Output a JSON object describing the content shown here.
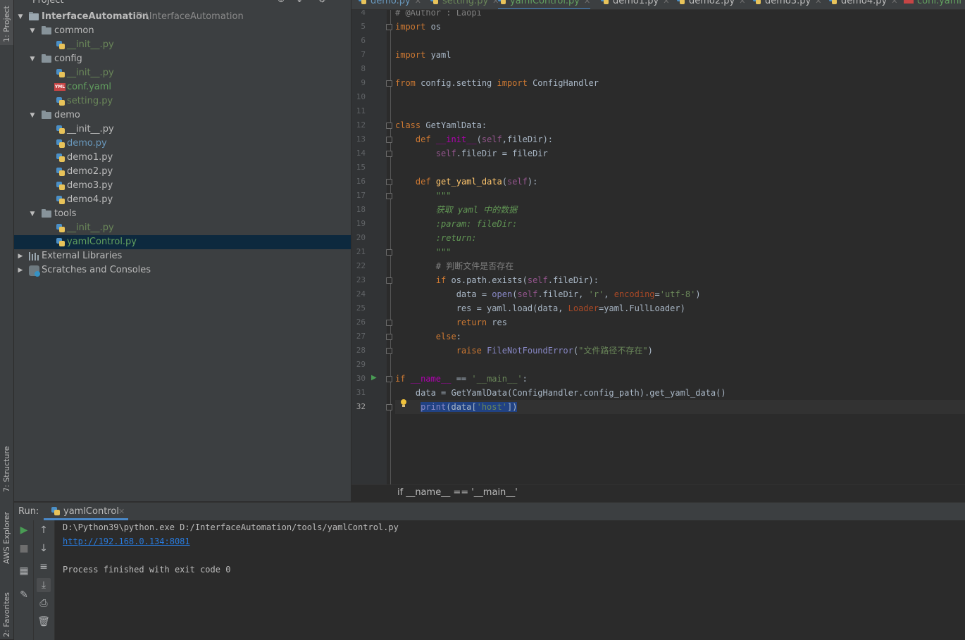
{
  "left_stripe": {
    "tabs": [
      {
        "label": "1: Project"
      },
      {
        "label": "7: Structure"
      },
      {
        "label": "AWS Explorer"
      },
      {
        "label": "2: Favorites"
      }
    ]
  },
  "project_panel": {
    "title": "Project",
    "tree": {
      "root": {
        "name": "InterfaceAutomation",
        "path": "D:\\InterfaceAutomation"
      },
      "items": [
        {
          "label": "common"
        },
        {
          "label": "__init__.py"
        },
        {
          "label": "config"
        },
        {
          "label": "__init__.py"
        },
        {
          "label": "conf.yaml"
        },
        {
          "label": "setting.py"
        },
        {
          "label": "demo"
        },
        {
          "label": "__init__.py"
        },
        {
          "label": "demo.py"
        },
        {
          "label": "demo1.py"
        },
        {
          "label": "demo2.py"
        },
        {
          "label": "demo3.py"
        },
        {
          "label": "demo4.py"
        },
        {
          "label": "tools"
        },
        {
          "label": "__init__.py"
        },
        {
          "label": "yamlControl.py"
        },
        {
          "label": "External Libraries"
        },
        {
          "label": "Scratches and Consoles"
        }
      ]
    }
  },
  "editor_tabs": [
    {
      "label": "demo.py"
    },
    {
      "label": "setting.py"
    },
    {
      "label": "yamlControl.py"
    },
    {
      "label": "demo1.py"
    },
    {
      "label": "demo2.py"
    },
    {
      "label": "demo3.py"
    },
    {
      "label": "demo4.py"
    },
    {
      "label": "conf.yaml"
    }
  ],
  "editor": {
    "line_numbers": [
      "4",
      "5",
      "6",
      "7",
      "8",
      "9",
      "10",
      "11",
      "12",
      "13",
      "14",
      "15",
      "16",
      "17",
      "18",
      "19",
      "20",
      "21",
      "22",
      "23",
      "24",
      "25",
      "26",
      "27",
      "28",
      "29",
      "30",
      "31",
      "32"
    ],
    "lines": {
      "l4": "# @Author : Laopi",
      "l5_kw": "import",
      "l5_rest": " os",
      "l7_kw": "import",
      "l7_rest": " yaml",
      "l9_kw1": "from",
      "l9_mid": " config.setting ",
      "l9_kw2": "import",
      "l9_rest": " ConfigHandler",
      "l12_kw": "class",
      "l12_rest": " GetYamlData:",
      "l13_kw": "def",
      "l13_fn": "__init__",
      "l13_a": "(",
      "l13_self": "self",
      "l13_b": ",fileDir):",
      "l14_self": "self",
      "l14_rest": ".fileDir = fileDir",
      "l16_kw": "def",
      "l16_fn": "get_yaml_data",
      "l16_a": "(",
      "l16_self": "self",
      "l16_b": "):",
      "l17": "\"\"\"",
      "l18": "获取 yaml 中的数据",
      "l19": ":param: fileDir:",
      "l20": ":return:",
      "l21": "\"\"\"",
      "l22": "# 判断文件是否存在",
      "l23_kw": "if",
      "l23_a": " os.path.exists(",
      "l23_self": "self",
      "l23_b": ".fileDir):",
      "l24_a": "data",
      "l24_b": " = ",
      "l24_fn": "open",
      "l24_c": "(",
      "l24_self": "self",
      "l24_d": ".fileDir, ",
      "l24_s1": "'r'",
      "l24_e": ", ",
      "l24_p": "encoding",
      "l24_f": "=",
      "l24_s2": "'utf-8'",
      "l24_g": ")",
      "l25_a": "res = yaml.load(data, ",
      "l25_p": "Loader",
      "l25_b": "=yaml.FullLoader)",
      "l26_kw": "return",
      "l26_rest": " res",
      "l27_kw": "else",
      "l27_rest": ":",
      "l28_kw": "raise",
      "l28_a": " ",
      "l28_fn": "FileNotFoundError",
      "l28_b": "(",
      "l28_s": "\"文件路径不存在\"",
      "l28_c": ")",
      "l30_kw": "if",
      "l30_a": " ",
      "l30_m1": "__name__",
      "l30_b": " == ",
      "l30_s": "'__main__'",
      "l30_c": ":",
      "l31": "    data = GetYamlData(ConfigHandler.config_path).get_yaml_data()",
      "l32_fn": "print",
      "l32_a": "(data[",
      "l32_s": "'host'",
      "l32_b": "])"
    },
    "breadcrumb": "if __name__ == '__main__'"
  },
  "run_panel": {
    "label": "Run:",
    "tab": "yamlControl",
    "console": [
      "D:\\Python39\\python.exe D:/InterfaceAutomation/tools/yamlControl.py",
      "http://192.168.0.134:8081",
      "",
      "Process finished with exit code 0"
    ]
  },
  "colors": {
    "selection": "#0d293e",
    "link": "#287bde",
    "active_tab_underline": "#4a88c7"
  }
}
